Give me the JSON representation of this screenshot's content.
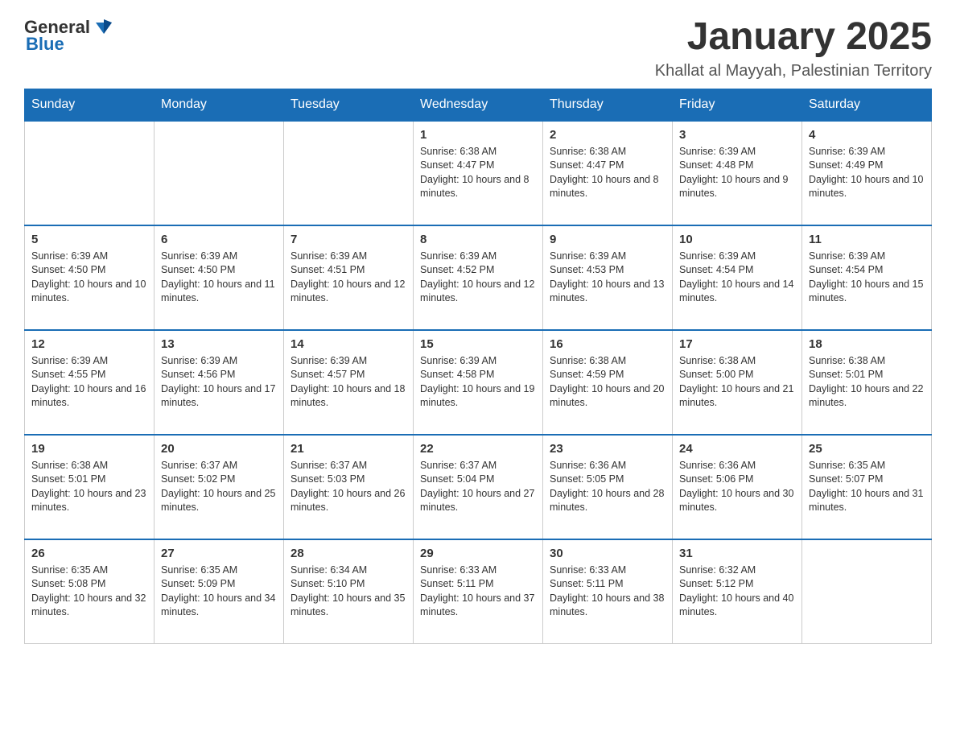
{
  "header": {
    "logo_general": "General",
    "logo_blue": "Blue",
    "month_title": "January 2025",
    "location": "Khallat al Mayyah, Palestinian Territory"
  },
  "weekdays": [
    "Sunday",
    "Monday",
    "Tuesday",
    "Wednesday",
    "Thursday",
    "Friday",
    "Saturday"
  ],
  "weeks": [
    [
      {
        "day": "",
        "info": ""
      },
      {
        "day": "",
        "info": ""
      },
      {
        "day": "",
        "info": ""
      },
      {
        "day": "1",
        "info": "Sunrise: 6:38 AM\nSunset: 4:47 PM\nDaylight: 10 hours and 8 minutes."
      },
      {
        "day": "2",
        "info": "Sunrise: 6:38 AM\nSunset: 4:47 PM\nDaylight: 10 hours and 8 minutes."
      },
      {
        "day": "3",
        "info": "Sunrise: 6:39 AM\nSunset: 4:48 PM\nDaylight: 10 hours and 9 minutes."
      },
      {
        "day": "4",
        "info": "Sunrise: 6:39 AM\nSunset: 4:49 PM\nDaylight: 10 hours and 10 minutes."
      }
    ],
    [
      {
        "day": "5",
        "info": "Sunrise: 6:39 AM\nSunset: 4:50 PM\nDaylight: 10 hours and 10 minutes."
      },
      {
        "day": "6",
        "info": "Sunrise: 6:39 AM\nSunset: 4:50 PM\nDaylight: 10 hours and 11 minutes."
      },
      {
        "day": "7",
        "info": "Sunrise: 6:39 AM\nSunset: 4:51 PM\nDaylight: 10 hours and 12 minutes."
      },
      {
        "day": "8",
        "info": "Sunrise: 6:39 AM\nSunset: 4:52 PM\nDaylight: 10 hours and 12 minutes."
      },
      {
        "day": "9",
        "info": "Sunrise: 6:39 AM\nSunset: 4:53 PM\nDaylight: 10 hours and 13 minutes."
      },
      {
        "day": "10",
        "info": "Sunrise: 6:39 AM\nSunset: 4:54 PM\nDaylight: 10 hours and 14 minutes."
      },
      {
        "day": "11",
        "info": "Sunrise: 6:39 AM\nSunset: 4:54 PM\nDaylight: 10 hours and 15 minutes."
      }
    ],
    [
      {
        "day": "12",
        "info": "Sunrise: 6:39 AM\nSunset: 4:55 PM\nDaylight: 10 hours and 16 minutes."
      },
      {
        "day": "13",
        "info": "Sunrise: 6:39 AM\nSunset: 4:56 PM\nDaylight: 10 hours and 17 minutes."
      },
      {
        "day": "14",
        "info": "Sunrise: 6:39 AM\nSunset: 4:57 PM\nDaylight: 10 hours and 18 minutes."
      },
      {
        "day": "15",
        "info": "Sunrise: 6:39 AM\nSunset: 4:58 PM\nDaylight: 10 hours and 19 minutes."
      },
      {
        "day": "16",
        "info": "Sunrise: 6:38 AM\nSunset: 4:59 PM\nDaylight: 10 hours and 20 minutes."
      },
      {
        "day": "17",
        "info": "Sunrise: 6:38 AM\nSunset: 5:00 PM\nDaylight: 10 hours and 21 minutes."
      },
      {
        "day": "18",
        "info": "Sunrise: 6:38 AM\nSunset: 5:01 PM\nDaylight: 10 hours and 22 minutes."
      }
    ],
    [
      {
        "day": "19",
        "info": "Sunrise: 6:38 AM\nSunset: 5:01 PM\nDaylight: 10 hours and 23 minutes."
      },
      {
        "day": "20",
        "info": "Sunrise: 6:37 AM\nSunset: 5:02 PM\nDaylight: 10 hours and 25 minutes."
      },
      {
        "day": "21",
        "info": "Sunrise: 6:37 AM\nSunset: 5:03 PM\nDaylight: 10 hours and 26 minutes."
      },
      {
        "day": "22",
        "info": "Sunrise: 6:37 AM\nSunset: 5:04 PM\nDaylight: 10 hours and 27 minutes."
      },
      {
        "day": "23",
        "info": "Sunrise: 6:36 AM\nSunset: 5:05 PM\nDaylight: 10 hours and 28 minutes."
      },
      {
        "day": "24",
        "info": "Sunrise: 6:36 AM\nSunset: 5:06 PM\nDaylight: 10 hours and 30 minutes."
      },
      {
        "day": "25",
        "info": "Sunrise: 6:35 AM\nSunset: 5:07 PM\nDaylight: 10 hours and 31 minutes."
      }
    ],
    [
      {
        "day": "26",
        "info": "Sunrise: 6:35 AM\nSunset: 5:08 PM\nDaylight: 10 hours and 32 minutes."
      },
      {
        "day": "27",
        "info": "Sunrise: 6:35 AM\nSunset: 5:09 PM\nDaylight: 10 hours and 34 minutes."
      },
      {
        "day": "28",
        "info": "Sunrise: 6:34 AM\nSunset: 5:10 PM\nDaylight: 10 hours and 35 minutes."
      },
      {
        "day": "29",
        "info": "Sunrise: 6:33 AM\nSunset: 5:11 PM\nDaylight: 10 hours and 37 minutes."
      },
      {
        "day": "30",
        "info": "Sunrise: 6:33 AM\nSunset: 5:11 PM\nDaylight: 10 hours and 38 minutes."
      },
      {
        "day": "31",
        "info": "Sunrise: 6:32 AM\nSunset: 5:12 PM\nDaylight: 10 hours and 40 minutes."
      },
      {
        "day": "",
        "info": ""
      }
    ]
  ]
}
